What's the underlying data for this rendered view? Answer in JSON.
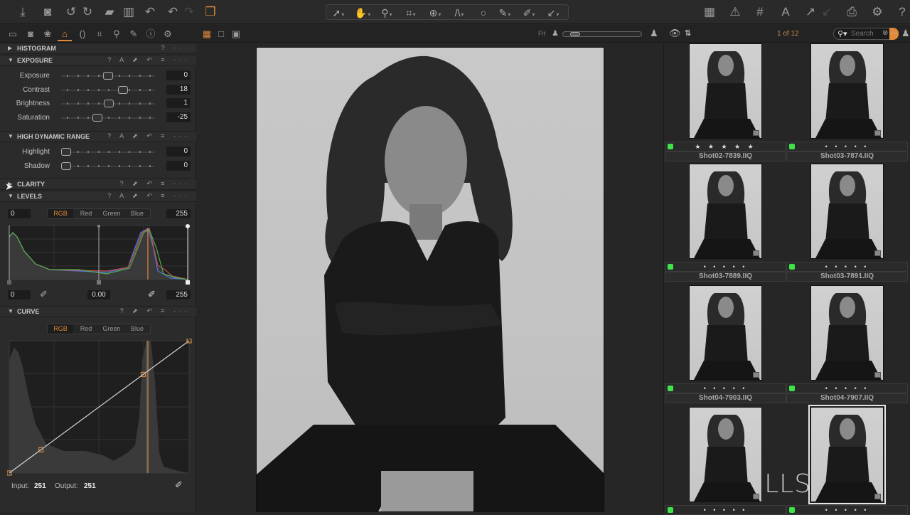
{
  "toolbar": {
    "left_icons": [
      "import-icon",
      "camera-icon",
      "rotate-left-icon",
      "rotate-right-icon",
      "move-to-folder-icon",
      "trash-icon",
      "undo-all-icon",
      "undo-icon",
      "redo-icon",
      "variants-icon"
    ],
    "cursor_tools": [
      "pointer-tool",
      "pan-tool",
      "zoom-tool",
      "crop-tool",
      "rotate-tool",
      "keystone-tool",
      "circle-tool",
      "brush-tool",
      "picker-tool",
      "annotate-tool"
    ],
    "right_icons": [
      "grid-view-icon",
      "warning-icon",
      "grid-overlay-icon",
      "text-icon",
      "export-icon",
      "import-arrow-icon",
      "print-icon",
      "settings-icon",
      "help-icon"
    ],
    "glyphs": {
      "import-icon": "⤓",
      "camera-icon": "◙",
      "rotate-left-icon": "↺",
      "rotate-right-icon": "↻",
      "move-to-folder-icon": "▰",
      "trash-icon": "🗑",
      "undo-all-icon": "↶",
      "undo-icon": "↶",
      "redo-icon": "↷",
      "variants-icon": "❐",
      "grid-view-icon": "▦",
      "warning-icon": "⚠",
      "grid-overlay-icon": "#",
      "text-icon": "A",
      "export-icon": "↗",
      "import-arrow-icon": "↙",
      "print-icon": "⎙",
      "settings-icon": "⚙",
      "help-icon": "?"
    }
  },
  "tool_tabs": [
    "library-tab",
    "capture-tab",
    "color-tab",
    "exposure-tab",
    "lens-tab",
    "crop-tab",
    "details-tab",
    "local-adjustments-tab",
    "metadata-tab",
    "output-tab"
  ],
  "viewer_bar": {
    "fit_label": "Fit",
    "zoom_level": 0.1
  },
  "browser_bar": {
    "counter": "1 of 12",
    "search_placeholder": "Search"
  },
  "left_panel": {
    "histogram": {
      "title": "HISTOGRAM",
      "collapsed": true
    },
    "exposure": {
      "title": "EXPOSURE",
      "sliders": [
        {
          "label": "Exposure",
          "value": "0",
          "position": 0.5
        },
        {
          "label": "Contrast",
          "value": "18",
          "position": 0.68
        },
        {
          "label": "Brightness",
          "value": "1",
          "position": 0.51
        },
        {
          "label": "Saturation",
          "value": "-25",
          "position": 0.375
        }
      ]
    },
    "hdr": {
      "title": "HIGH DYNAMIC RANGE",
      "sliders": [
        {
          "label": "Highlight",
          "value": "0",
          "position": 0.0
        },
        {
          "label": "Shadow",
          "value": "0",
          "position": 0.0
        }
      ]
    },
    "clarity": {
      "title": "CLARITY",
      "collapsed": true
    },
    "levels": {
      "title": "LEVELS",
      "channels": [
        "RGB",
        "Red",
        "Green",
        "Blue"
      ],
      "active_channel": "RGB",
      "output_low": "0",
      "output_high": "255",
      "input_low": "0",
      "midtone": "0.00",
      "input_high": "255"
    },
    "curve": {
      "title": "CURVE",
      "channels": [
        "RGB",
        "Red",
        "Green",
        "Blue"
      ],
      "active_channel": "RGB",
      "input_label": "Input:",
      "input_value": "251",
      "output_label": "Output:",
      "output_value": "251",
      "points": [
        [
          0,
          0
        ],
        [
          45,
          45
        ],
        [
          190,
          190
        ],
        [
          255,
          255
        ]
      ]
    }
  },
  "thumbnails": [
    {
      "name": "Shot02-7839.IIQ",
      "rating": "★ ★ ★ ★ ★",
      "color_tag": "#3ee34a",
      "selected": false
    },
    {
      "name": "Shot03-7874.IIQ",
      "rating": "• • • • •",
      "color_tag": "#3ee34a",
      "selected": false
    },
    {
      "name": "Shot03-7889.IIQ",
      "rating": "• • • • •",
      "color_tag": "#3ee34a",
      "selected": false
    },
    {
      "name": "Shot03-7891.IIQ",
      "rating": "• • • • •",
      "color_tag": "#3ee34a",
      "selected": false
    },
    {
      "name": "Shot04-7903.IIQ",
      "rating": "• • • • •",
      "color_tag": "#3ee34a",
      "selected": false
    },
    {
      "name": "Shot04-7907.IIQ",
      "rating": "• • • • •",
      "color_tag": "#3ee34a",
      "selected": false
    },
    {
      "name": "",
      "rating": "• • • • •",
      "color_tag": "#3ee34a",
      "selected": false
    },
    {
      "name": "",
      "rating": "• • • • •",
      "color_tag": "#3ee34a",
      "selected": true
    }
  ],
  "watermark": "SKILLSHARE",
  "accent_color": "#e08a3c"
}
